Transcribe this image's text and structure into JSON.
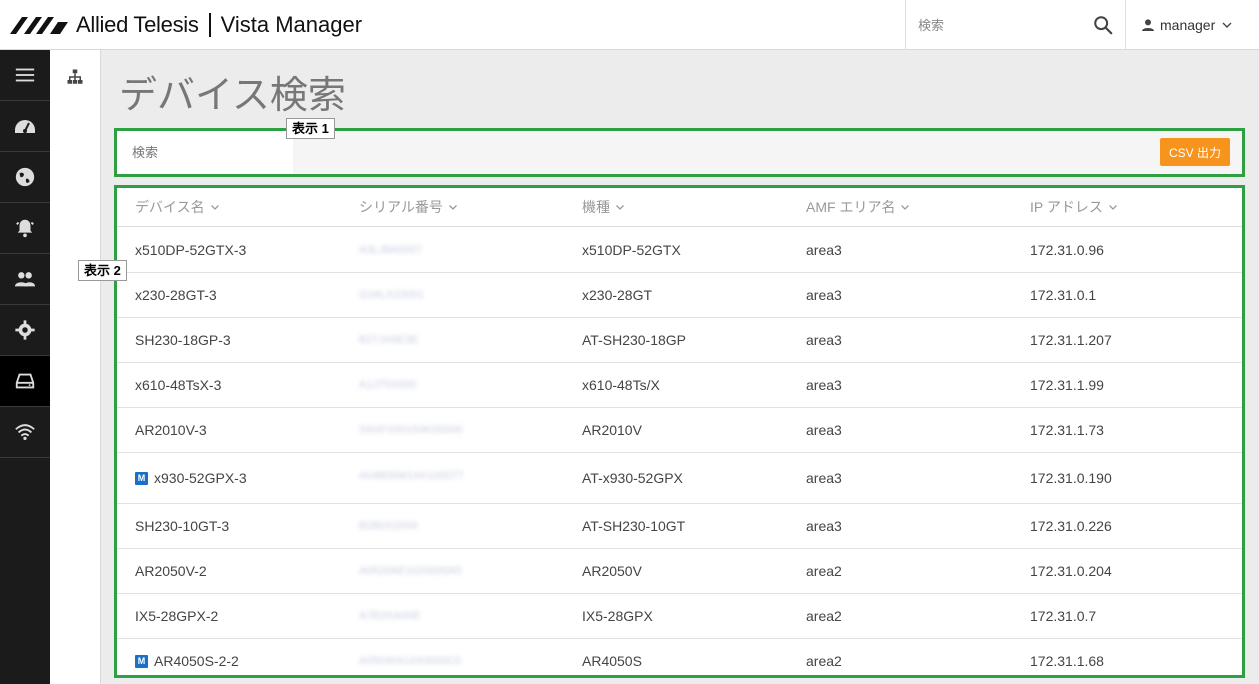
{
  "header": {
    "brand": "Allied Telesis",
    "product": "Vista Manager",
    "search_placeholder": "検索",
    "user": "manager"
  },
  "nav": {
    "items": [
      {
        "name": "menu-icon"
      },
      {
        "name": "dashboard-icon"
      },
      {
        "name": "globe-icon"
      },
      {
        "name": "alarm-icon"
      },
      {
        "name": "users-icon"
      },
      {
        "name": "settings-icon"
      },
      {
        "name": "device-icon",
        "active": true
      },
      {
        "name": "wifi-icon"
      }
    ]
  },
  "page": {
    "title": "デバイス検索",
    "filter_placeholder": "検索",
    "csv_button": "CSV 出力",
    "callout1": "表示 1",
    "callout2": "表示 2"
  },
  "table": {
    "headers": [
      "デバイス名",
      "シリアル番号",
      "機種",
      "AMF エリア名",
      "IP アドレス"
    ],
    "rows": [
      {
        "name": "x510DP-52GTX-3",
        "serial": "A3LJ8A0007",
        "model": "x510DP-52GTX",
        "area": "area3",
        "ip": "172.31.0.96",
        "badge": ""
      },
      {
        "name": "x230-28GT-3",
        "serial": "G34LX23001",
        "model": "x230-28GT",
        "area": "area3",
        "ip": "172.31.0.1",
        "badge": ""
      },
      {
        "name": "SH230-18GP-3",
        "serial": "B27JX6E3E",
        "model": "AT-SH230-18GP",
        "area": "area3",
        "ip": "172.31.1.207",
        "badge": ""
      },
      {
        "name": "x610-48TsX-3",
        "serial": "A1JT5X000",
        "model": "x610-48Ts/X",
        "area": "area3",
        "ip": "172.31.1.99",
        "badge": ""
      },
      {
        "name": "AR2010V-3",
        "serial": "S9XFX00154K00000",
        "model": "AR2010V",
        "area": "area3",
        "ip": "172.31.1.73",
        "badge": ""
      },
      {
        "name": "x930-52GPX-3",
        "serial": "A04800W14X100077",
        "model": "AT-x930-52GPX",
        "area": "area3",
        "ip": "172.31.0.190",
        "badge": "M"
      },
      {
        "name": "SH230-10GT-3",
        "serial": "B2B0X2004",
        "model": "AT-SH230-10GT",
        "area": "area3",
        "ip": "172.31.0.226",
        "badge": ""
      },
      {
        "name": "AR2050V-2",
        "serial": "A0520AE1020000A5",
        "model": "AR2050V",
        "area": "area2",
        "ip": "172.31.0.204",
        "badge": ""
      },
      {
        "name": "IX5-28GPX-2",
        "serial": "A7E0XA00E",
        "model": "IX5-28GPX",
        "area": "area2",
        "ip": "172.31.0.7",
        "badge": ""
      },
      {
        "name": "AR4050S-2-2",
        "serial": "A05040414X0000C0",
        "model": "AR4050S",
        "area": "area2",
        "ip": "172.31.1.68",
        "badge": "M"
      }
    ]
  },
  "colors": {
    "accent": "#f7941d",
    "highlight_border": "#2ea043",
    "badge": "#1a6fc9"
  }
}
